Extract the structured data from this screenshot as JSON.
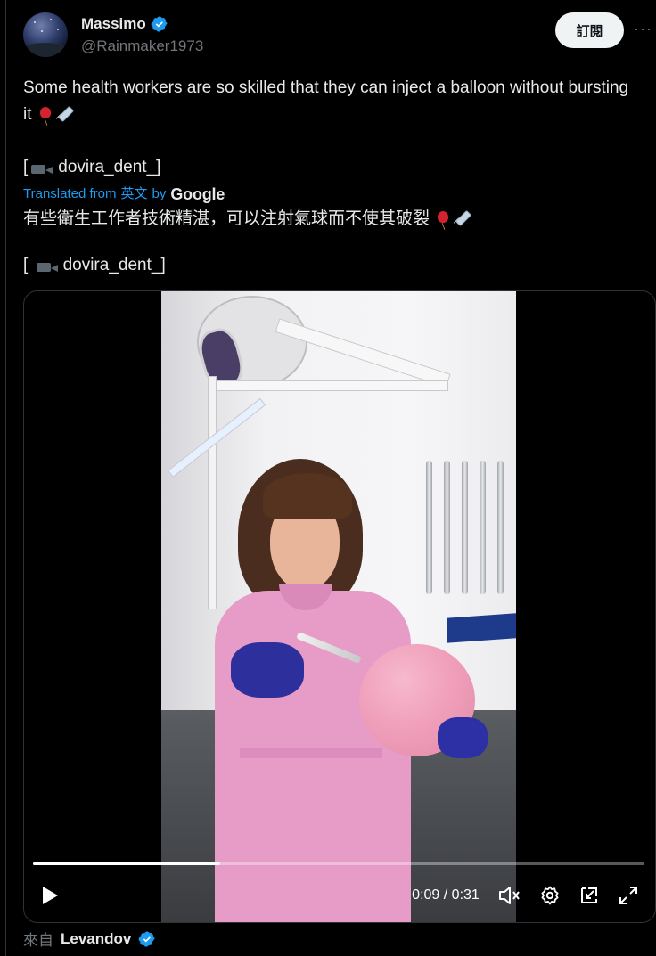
{
  "author": {
    "display_name": "Massimo",
    "handle": "@Rainmaker1973",
    "verified": true
  },
  "actions": {
    "subscribe_label": "訂閱",
    "more_label": "···"
  },
  "post": {
    "text_line": "Some health workers are so skilled that they can inject a balloon without bursting it",
    "source_credit": "dovira_dent_",
    "translation": {
      "translated_from": "Translated from",
      "source_language": "英文",
      "by": "by",
      "provider": "Google",
      "text": "有些衛生工作者技術精湛，可以注射氣球而不使其破裂",
      "source_credit": "dovira_dent_"
    },
    "emoji": [
      "balloon",
      "syringe",
      "movie-camera"
    ]
  },
  "video": {
    "current_time": "0:09",
    "separator": "/",
    "duration": "0:31",
    "progress_fraction": 0.306,
    "controls": [
      "play-icon",
      "volume-icon",
      "settings-gear-icon",
      "picture-in-picture-icon",
      "fullscreen-icon"
    ]
  },
  "attribution": {
    "prefix": "來自",
    "name": "Levandov",
    "verified": true
  },
  "colors": {
    "background": "#000000",
    "text": "#e7e9ea",
    "muted": "#71767b",
    "link": "#1d9bf0",
    "verified_blue": "#1d9bf0",
    "subscribe_bg": "#eff3f4"
  }
}
